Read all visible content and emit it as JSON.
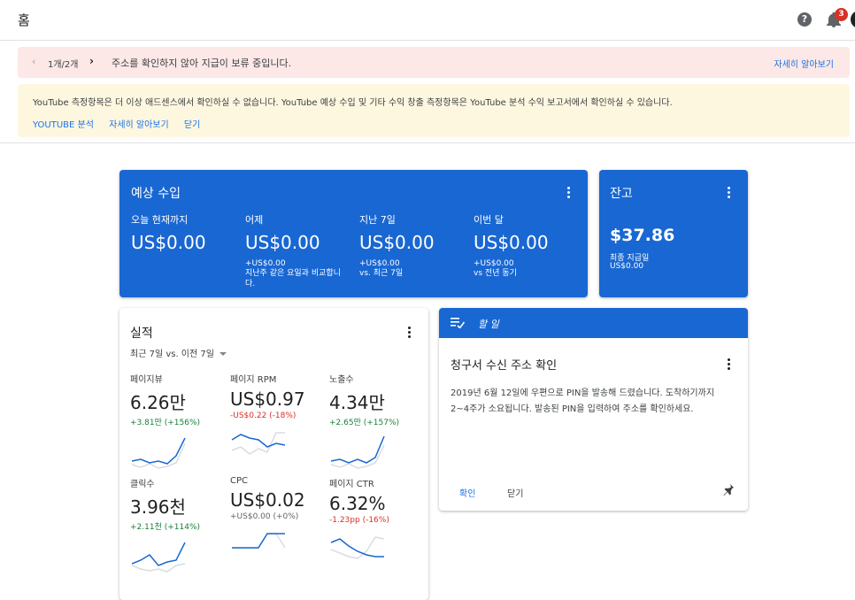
{
  "header": {
    "title": "홈",
    "help_icon": "help-icon",
    "bell_icon": "bell-icon",
    "notification_count": "3"
  },
  "alert_red": {
    "pager": "1개/2개",
    "message": "주소를 확인하지 않아 지급이 보류 중입니다.",
    "more_link": "자세히 알아보기",
    "color": "#fce8e6"
  },
  "alert_yellow": {
    "message": "YouTube 측정항목은 더 이상 애드센스에서 확인하실 수 없습니다. YouTube 예상 수입 및 기타 수익 창출 측정항목은 YouTube 분석 수익 보고서에서 확인하실 수 있습니다.",
    "links": [
      "YOUTUBE 분석",
      "자세히 알아보기",
      "닫기"
    ],
    "color": "#fef7e0"
  },
  "estimated": {
    "title": "예상 수입",
    "columns": [
      {
        "label": "오늘 현재까지",
        "amount": "US$0.00",
        "sub1": "",
        "sub2": ""
      },
      {
        "label": "어제",
        "amount": "US$0.00",
        "sub1": "+US$0.00",
        "sub2": "지난주 같은 요일과 비교합니다."
      },
      {
        "label": "지난 7일",
        "amount": "US$0.00",
        "sub1": "+US$0.00",
        "sub2": "vs. 최근 7일"
      },
      {
        "label": "이번 달",
        "amount": "US$0.00",
        "sub1": "+US$0.00",
        "sub2": "vs 전년 동기"
      }
    ],
    "color": "#1967d2"
  },
  "balance": {
    "title": "잔고",
    "amount": "$37.86",
    "last_paid_label": "최종 지급일",
    "last_paid_amount": "US$0.00"
  },
  "performance": {
    "title": "실적",
    "range": "최근 7일 vs. 이전 7일",
    "metrics": [
      {
        "label": "페이지뷰",
        "value": "6.26만",
        "change": "+3.81만 (+156%)",
        "trend": "up"
      },
      {
        "label": "페이지 RPM",
        "value": "US$0.97",
        "change": "-US$0.22 (-18%)",
        "trend": "down"
      },
      {
        "label": "노출수",
        "value": "4.34만",
        "change": "+2.65만 (+157%)",
        "trend": "up"
      },
      {
        "label": "클릭수",
        "value": "3.96천",
        "change": "+2.11천 (+114%)",
        "trend": "up"
      },
      {
        "label": "CPC",
        "value": "US$0.02",
        "change": "+US$0.00 (+0%)",
        "trend": "flat"
      },
      {
        "label": "페이지 CTR",
        "value": "6.32%",
        "change": "-1.23pp (-16%)",
        "trend": "down"
      }
    ]
  },
  "todo": {
    "header": "할 일",
    "title": "청구서 수신 주소 확인",
    "body": "2019년 6월 12일에 우편으로 PIN을 발송해 드렸습니다. 도착하기까지 2~4주가 소요됩니다. 발송된 PIN을 입력하여 주소를 확인하세요.",
    "confirm": "확인",
    "close": "닫기",
    "pin_icon": "pin-icon"
  }
}
